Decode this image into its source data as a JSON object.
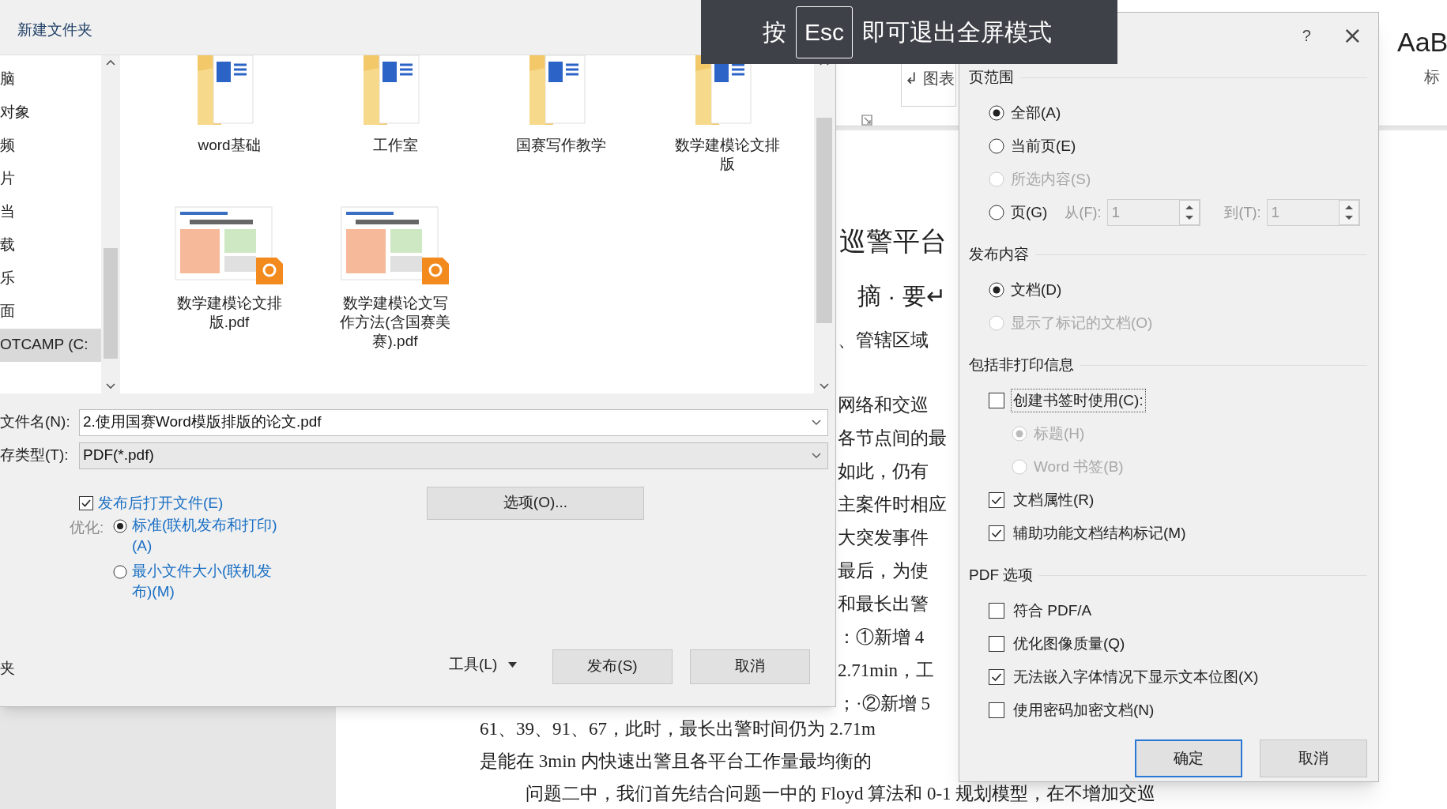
{
  "fullscreen_notice": {
    "prefix": "按",
    "key": "Esc",
    "suffix": "即可退出全屏模式"
  },
  "word_window": {
    "ribbon": {
      "style_left": "↲ 图表",
      "style_right_sample": "AaB",
      "style_right_label": "标"
    },
    "heading": "巡警平台",
    "abstract_title": "摘 · 要↵",
    "fragments": [
      "、管辖区域",
      "网络和交巡",
      "各节点间的最",
      "如此，仍有",
      "主案件时相应",
      "大突发事件",
      "最后，为使",
      "和最长出警",
      "：①新增 4",
      "2.71min，工",
      "；·②新增 5"
    ],
    "lines": [
      "61、39、91、67，此时，最长出警时间仍为 2.71m",
      "是能在 3min 内快速出警且各平台工作量最均衡的",
      "问题二中，我们首先结合问题一中的 Floyd 算法和 0-1 规划模型，在不增加交巡"
    ]
  },
  "save_dialog": {
    "new_folder": "新建文件夹",
    "sidebar": [
      {
        "label": "脑",
        "selected": false
      },
      {
        "label": "对象",
        "selected": false
      },
      {
        "label": "频",
        "selected": false
      },
      {
        "label": "片",
        "selected": false
      },
      {
        "label": "当",
        "selected": false
      },
      {
        "label": "载",
        "selected": false
      },
      {
        "label": "乐",
        "selected": false
      },
      {
        "label": "面",
        "selected": false
      },
      {
        "label": "OTCAMP (C:",
        "selected": true
      }
    ],
    "files": [
      {
        "name": "word基础",
        "kind": "folder"
      },
      {
        "name": "工作室",
        "kind": "folder"
      },
      {
        "name": "国赛写作教学",
        "kind": "folder"
      },
      {
        "name": "数学建模论文排版",
        "kind": "folder"
      },
      {
        "name": "数学建模论文排版.pdf",
        "kind": "pdf"
      },
      {
        "name": "数学建模论文写作方法(含国赛美赛).pdf",
        "kind": "pdf"
      }
    ],
    "filename": {
      "label": "文件名(N):",
      "value": "2.使用国赛Word模版排版的论文.pdf"
    },
    "filetype": {
      "label": "存类型(T):",
      "value": "PDF(*.pdf)"
    },
    "open_after_publish": {
      "label": "发布后打开文件(E)",
      "checked": true
    },
    "optimize": {
      "label": "优化:",
      "options": [
        {
          "label": "标准(联机发布和打印)(A)",
          "selected": true
        },
        {
          "label": "最小文件大小(联机发布)(M)",
          "selected": false
        }
      ]
    },
    "options_button": "选项(O)...",
    "footer_left": "夹",
    "tools_button": "工具(L)",
    "publish_button": "发布(S)",
    "cancel_button": "取消"
  },
  "options_dialog": {
    "help": "?",
    "close": "×",
    "sections": [
      {
        "title": "页范围",
        "items": [
          {
            "kind": "radio",
            "label": "全部(A)",
            "selected": true,
            "disabled": false
          },
          {
            "kind": "radio",
            "label": "当前页(E)",
            "selected": false,
            "disabled": false
          },
          {
            "kind": "radio",
            "label": "所选内容(S)",
            "selected": false,
            "disabled": true
          },
          {
            "kind": "range",
            "label": "页(G)",
            "selected": false,
            "disabled": false,
            "from_label": "从(F):",
            "from_value": "1",
            "to_label": "到(T):",
            "to_value": "1"
          }
        ]
      },
      {
        "title": "发布内容",
        "items": [
          {
            "kind": "radio",
            "label": "文档(D)",
            "selected": true,
            "disabled": false
          },
          {
            "kind": "radio",
            "label": "显示了标记的文档(O)",
            "selected": false,
            "disabled": true
          }
        ]
      },
      {
        "title": "包括非打印信息",
        "items": [
          {
            "kind": "checkbox",
            "label": "创建书签时使用(C):",
            "checked": false,
            "focused": true
          },
          {
            "kind": "subradio",
            "label": "标题(H)",
            "selected": true,
            "disabled": true
          },
          {
            "kind": "subradio",
            "label": "Word 书签(B)",
            "selected": false,
            "disabled": true
          },
          {
            "kind": "checkbox",
            "label": "文档属性(R)",
            "checked": true,
            "focused": false
          },
          {
            "kind": "checkbox",
            "label": "辅助功能文档结构标记(M)",
            "checked": true,
            "focused": false
          }
        ]
      },
      {
        "title": "PDF 选项",
        "items": [
          {
            "kind": "checkbox",
            "label": "符合 PDF/A",
            "checked": false,
            "focused": false
          },
          {
            "kind": "checkbox",
            "label": "优化图像质量(Q)",
            "checked": false,
            "focused": false
          },
          {
            "kind": "checkbox",
            "label": "无法嵌入字体情况下显示文本位图(X)",
            "checked": true,
            "focused": false
          },
          {
            "kind": "checkbox",
            "label": "使用密码加密文档(N)",
            "checked": false,
            "focused": false
          }
        ]
      }
    ],
    "buttons": [
      {
        "label": "确定",
        "default": true
      },
      {
        "label": "取消",
        "default": false
      }
    ]
  }
}
